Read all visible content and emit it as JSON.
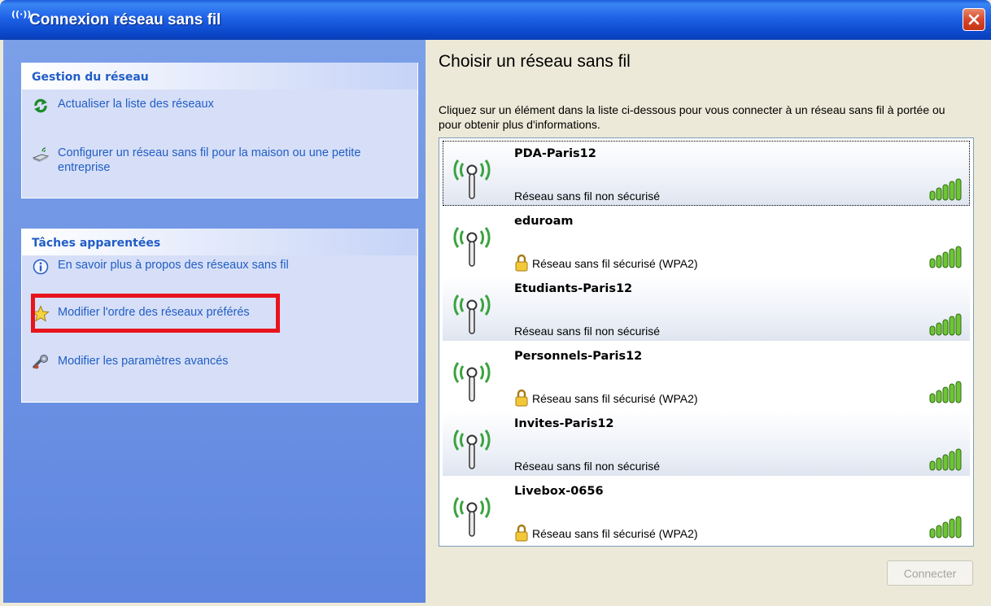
{
  "window": {
    "title": "Connexion réseau sans fil",
    "title_icon": "((·))"
  },
  "left": {
    "network_tasks": {
      "heading": "Gestion du réseau",
      "items": [
        {
          "label": "Actualiser la liste des réseaux",
          "icon": "refresh-icon"
        },
        {
          "label": "Configurer un réseau sans fil pour la maison ou une petite entreprise",
          "icon": "wireless-setup-icon"
        }
      ]
    },
    "related_tasks": {
      "heading": "Tâches apparentées",
      "items": [
        {
          "label": "En savoir plus à propos des réseaux sans fil",
          "icon": "info-icon"
        },
        {
          "label": "Modifier l'ordre des réseaux préférés",
          "icon": "star-icon"
        },
        {
          "label": "Modifier les paramètres avancés",
          "icon": "settings-icon"
        }
      ]
    }
  },
  "main": {
    "title": "Choisir un réseau sans fil",
    "description": "Cliquez sur un élément dans la liste ci-dessous pour vous connecter à un réseau sans fil à portée ou pour obtenir plus d'informations.",
    "networks": [
      {
        "name": "PDA-Paris12",
        "status": "Réseau sans fil non sécurisé",
        "secured": false,
        "signal_bars": 5
      },
      {
        "name": "eduroam",
        "status": "Réseau sans fil sécurisé (WPA2)",
        "secured": true,
        "signal_bars": 5
      },
      {
        "name": "Etudiants-Paris12",
        "status": "Réseau sans fil non sécurisé",
        "secured": false,
        "signal_bars": 5
      },
      {
        "name": "Personnels-Paris12",
        "status": "Réseau sans fil sécurisé (WPA2)",
        "secured": true,
        "signal_bars": 5
      },
      {
        "name": "Invites-Paris12",
        "status": "Réseau sans fil non sécurisé",
        "secured": false,
        "signal_bars": 5
      },
      {
        "name": "Livebox-0656",
        "status": "Réseau sans fil sécurisé (WPA2)",
        "secured": true,
        "signal_bars": 5
      }
    ],
    "connect_label": "Connecter"
  },
  "colors": {
    "link": "#215dc6",
    "highlight": "#e8141c",
    "titlebar": "#0a46c8"
  }
}
